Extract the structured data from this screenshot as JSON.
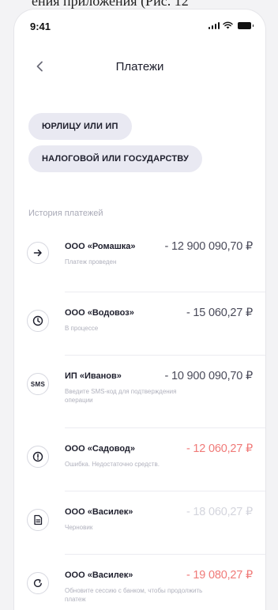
{
  "caption_fragment": "ения приложения (Рис. 12",
  "status_bar": {
    "time": "9:41"
  },
  "header": {
    "title": "Платежи"
  },
  "chips": [
    {
      "label": "ЮРЛИЦУ ИЛИ ИП"
    },
    {
      "label": "НАЛОГОВОЙ ИЛИ ГОСУДАРСТВУ"
    }
  ],
  "history": {
    "label": "История платежей",
    "items": [
      {
        "name": "ООО «Ромашка»",
        "amount": "- 12 900 090,70 ₽",
        "status": "Платеж проведен",
        "icon": "arrow-right-icon",
        "state": "done"
      },
      {
        "name": "ООО «Водовоз»",
        "amount": "- 15 060,27 ₽",
        "status": "В процессе",
        "icon": "clock-icon",
        "state": "processing"
      },
      {
        "name": "ИП «Иванов»",
        "amount": "- 10 900 090,70 ₽",
        "status": "Введите SMS-код для подтверждения операции",
        "icon": "sms-icon",
        "icon_text": "SMS",
        "state": "sms"
      },
      {
        "name": "ООО «Садовод»",
        "amount": "- 12 060,27 ₽",
        "status": "Ошибка. Недостаточно средств.",
        "icon": "exclamation-icon",
        "state": "error"
      },
      {
        "name": "ООО «Василек»",
        "amount": "- 18 060,27 ₽",
        "status": "Черновик",
        "icon": "document-icon",
        "state": "draft"
      },
      {
        "name": "ООО «Василек»",
        "amount": "- 19 080,27 ₽",
        "status": "Обновите сессию с банком, чтобы продолжить платеж",
        "icon": "refresh-icon",
        "state": "expired"
      }
    ]
  },
  "colors": {
    "accent_error": "#f07a78",
    "amount_default": "#4a4b5a",
    "amount_draft": "#d4d5dd",
    "chip_bg": "#e9e9f2",
    "muted_text": "#a9aab7"
  }
}
